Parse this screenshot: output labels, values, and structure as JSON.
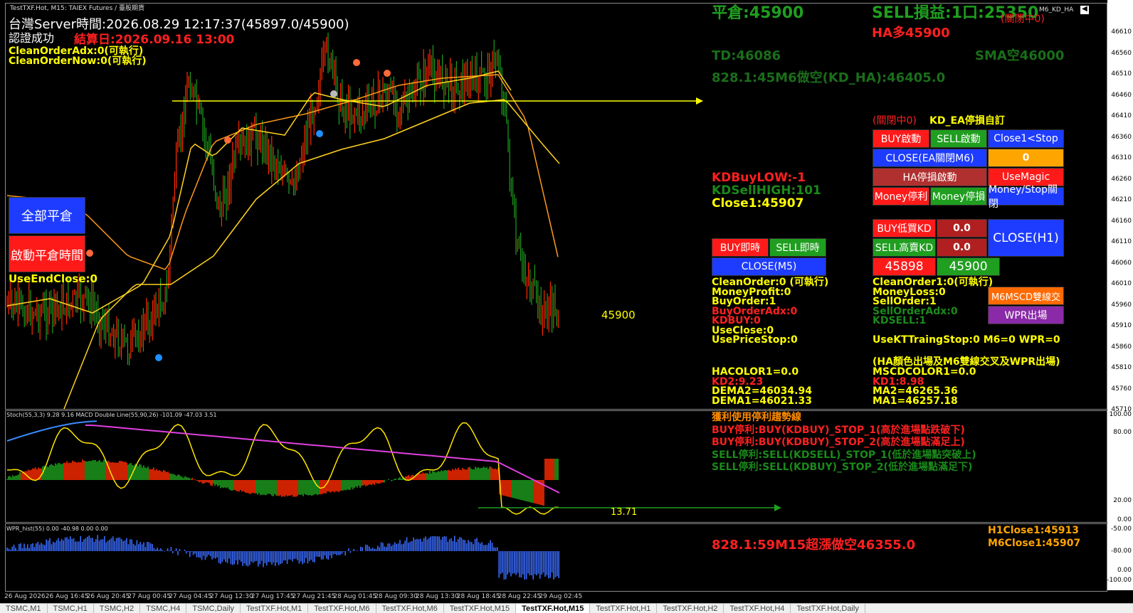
{
  "window": {
    "title": "TestTXF.Hot, M15:  TAIEX Futures / 臺股期貨",
    "right_caption": "M6_KD_HA"
  },
  "header_left": {
    "server_time": "台灣Server時間:2026.08.29 12:17:37(45897.0/45900)",
    "auth": "認證成功",
    "settle_date": "結算日:2026.09.16 13:00",
    "clean_adx": "CleanOrderAdx:0(可執行)",
    "clean_now": "CleanOrderNow:0(可執行)"
  },
  "left_buttons": {
    "close_all": "全部平倉",
    "start_close_time": "啟動平倉時間",
    "use_end_close": "UseEndClose:0"
  },
  "top_info": {
    "flat_price": "平倉:45900",
    "sell_pnl": "SELL損益:1口:25350",
    "closed_tag": "(關閉中0)",
    "ha_label": "HA多45900",
    "td": "TD:46086",
    "sma": "SMA空46000",
    "m6_line": "828.1:45M6做空(KD_HA):46405.0"
  },
  "mid_info": {
    "kd_buy_low": "KDBuyLOW:-1",
    "kd_sell_high": "KDSellHIGH:101",
    "close1": "Close1:45907"
  },
  "ea_panel": {
    "closed": "(關閉中0)",
    "title": "KD_EA停損自訂",
    "buy_start": "BUY啟動",
    "sell_start": "SELL啟動",
    "close_stop": "Close1<Stop",
    "close_ea": "CLOSE(EA關閉M6)",
    "zero": "0",
    "ha_stop": "HA停損啟動",
    "use_magic": "UseMagic",
    "money_profit": "Money停利",
    "money_loss": "Money停損",
    "money_stop": "Money/Stop關閉"
  },
  "kd_panel": {
    "buy_low_kd": "BUY低買KD",
    "buy_val": "0.0",
    "sell_high_kd": "SELL高賣KD",
    "sell_val": "0.0",
    "close_h1": "CLOSE(H1)",
    "price_a": "45898",
    "price_b": "45900"
  },
  "quick_panel": {
    "buy_now": "BUY即時",
    "sell_now": "SELL即時",
    "close_m5": "CLOSE(M5)"
  },
  "stats_left": [
    {
      "text": "CleanOrder:0 (可執行)",
      "color": "#ffff00"
    },
    {
      "text": "MoneyProfit:0",
      "color": "#ffff00"
    },
    {
      "text": "BuyOrder:1",
      "color": "#ffff00"
    },
    {
      "text": "BuyOrderAdx:0",
      "color": "#ff2020"
    },
    {
      "text": "KDBUY:0",
      "color": "#ff2020"
    },
    {
      "text": "UseClose:0",
      "color": "#ffff00"
    },
    {
      "text": "UsePriceStop:0",
      "color": "#ffff00"
    }
  ],
  "stats_right": [
    {
      "text": "CleanOrder1:0(可執行)",
      "color": "#ffff00"
    },
    {
      "text": "MoneyLoss:0",
      "color": "#ffff00"
    },
    {
      "text": "SellOrder:1",
      "color": "#ffff00"
    },
    {
      "text": "SellOrderAdx:0",
      "color": "#1a8a1a"
    },
    {
      "text": "KDSELL:1",
      "color": "#1a8a1a"
    }
  ],
  "side_buttons": {
    "m6_cross": "M6MSCD雙線交",
    "wpr_exit": "WPR出場"
  },
  "trailing": "UseKTTraingStop:0  M6=0  WPR=0",
  "ha_note": "(HA顏色出場及M6雙線交叉及WPR出場)",
  "indicators_left": [
    {
      "text": "HACOLOR1=0.0",
      "color": "#ffff00"
    },
    {
      "text": "KD2:9.23",
      "color": "#ff2020"
    },
    {
      "text": "DEMA2=46034.94",
      "color": "#ffff00"
    },
    {
      "text": "DEMA1=46021.33",
      "color": "#ffff00"
    }
  ],
  "indicators_right": [
    {
      "text": "MSCDCOLOR1=0.0",
      "color": "#ffff00"
    },
    {
      "text": "KD1:8.98",
      "color": "#ff2020"
    },
    {
      "text": "MA2=46265.36",
      "color": "#ffff00"
    },
    {
      "text": "MA1=46257.18",
      "color": "#ffff00"
    }
  ],
  "profit_rules": [
    {
      "text": "獲利使用停利趨勢線",
      "color": "#ff8c00"
    },
    {
      "text": "BUY停利:BUY(KDBUY)_STOP_1(高於進場點跌破下)",
      "color": "#ff2020"
    },
    {
      "text": "BUY停利:BUY(KDBUY)_STOP_2(高於進場點滿足上)",
      "color": "#ff2020"
    },
    {
      "text": "SELL停利:SELL(KDSELL)_STOP_1(低於進場點突破上)",
      "color": "#1a8a1a"
    },
    {
      "text": "SELL停利:SELL(KDBUY)_STOP_2(低於進場點滿足下)",
      "color": "#1a8a1a"
    }
  ],
  "bottom_info": {
    "m15_short": "828.1:59M15超漲做空46355.0",
    "h1close": "H1Close1:45913",
    "m6close": "M6Close1:45907"
  },
  "chart_labels": {
    "price_label": "45900",
    "macd_value": "13.71",
    "sub1_caption": "Stoch(55,3,3) 9.28 9.16 MACD Double Line(55,90,26) -101.09 -47.03 3.51",
    "sub2_caption": "WPR_hist(55) 0.00 -40.98 0.00 0.00"
  },
  "price_axis": [
    "46610",
    "46560",
    "46510",
    "46460",
    "46410",
    "46360",
    "46310",
    "46260",
    "46210",
    "46160",
    "46110",
    "46060",
    "46010",
    "45960",
    "45910",
    "45860",
    "45810",
    "45760",
    "45710"
  ],
  "sub1_axis": [
    "100.00",
    "80.00",
    "20.00",
    "0.00"
  ],
  "sub2_axis": [
    "-50.00",
    "-80.00",
    "0.00",
    "-100.00"
  ],
  "time_axis": [
    "26 Aug 2026",
    "26 Aug 16:45",
    "26 Aug 20:45",
    "27 Aug 00:45",
    "27 Aug 04:45",
    "27 Aug 12:30",
    "27 Aug 17:45",
    "27 Aug 21:45",
    "28 Aug 01:45",
    "28 Aug 09:30",
    "28 Aug 13:30",
    "28 Aug 18:45",
    "28 Aug 22:45",
    "29 Aug 02:45"
  ],
  "tabs": [
    "TSMC,M1",
    "TSMC,H1",
    "TSMC,H2",
    "TSMC,H4",
    "TSMC,Daily",
    "TestTXF.Hot,M1",
    "TestTXF.Hot,M6",
    "TestTXF.Hot,M6",
    "TestTXF.Hot,M15",
    "TestTXF.Hot,M15",
    "TestTXF.Hot,H1",
    "TestTXF.Hot,H2",
    "TestTXF.Hot,H4",
    "TestTXF.Hot,Daily"
  ],
  "active_tab_index": 9,
  "colors": {
    "bull": "#ff2a00",
    "bear": "#1f9e1f",
    "ma_yellow": "#ffd21f",
    "ma_orange": "#ff9a1a",
    "trendline": "#ffff00",
    "macd_line": "#e040e0",
    "stoch_blue": "#3b8cff"
  }
}
